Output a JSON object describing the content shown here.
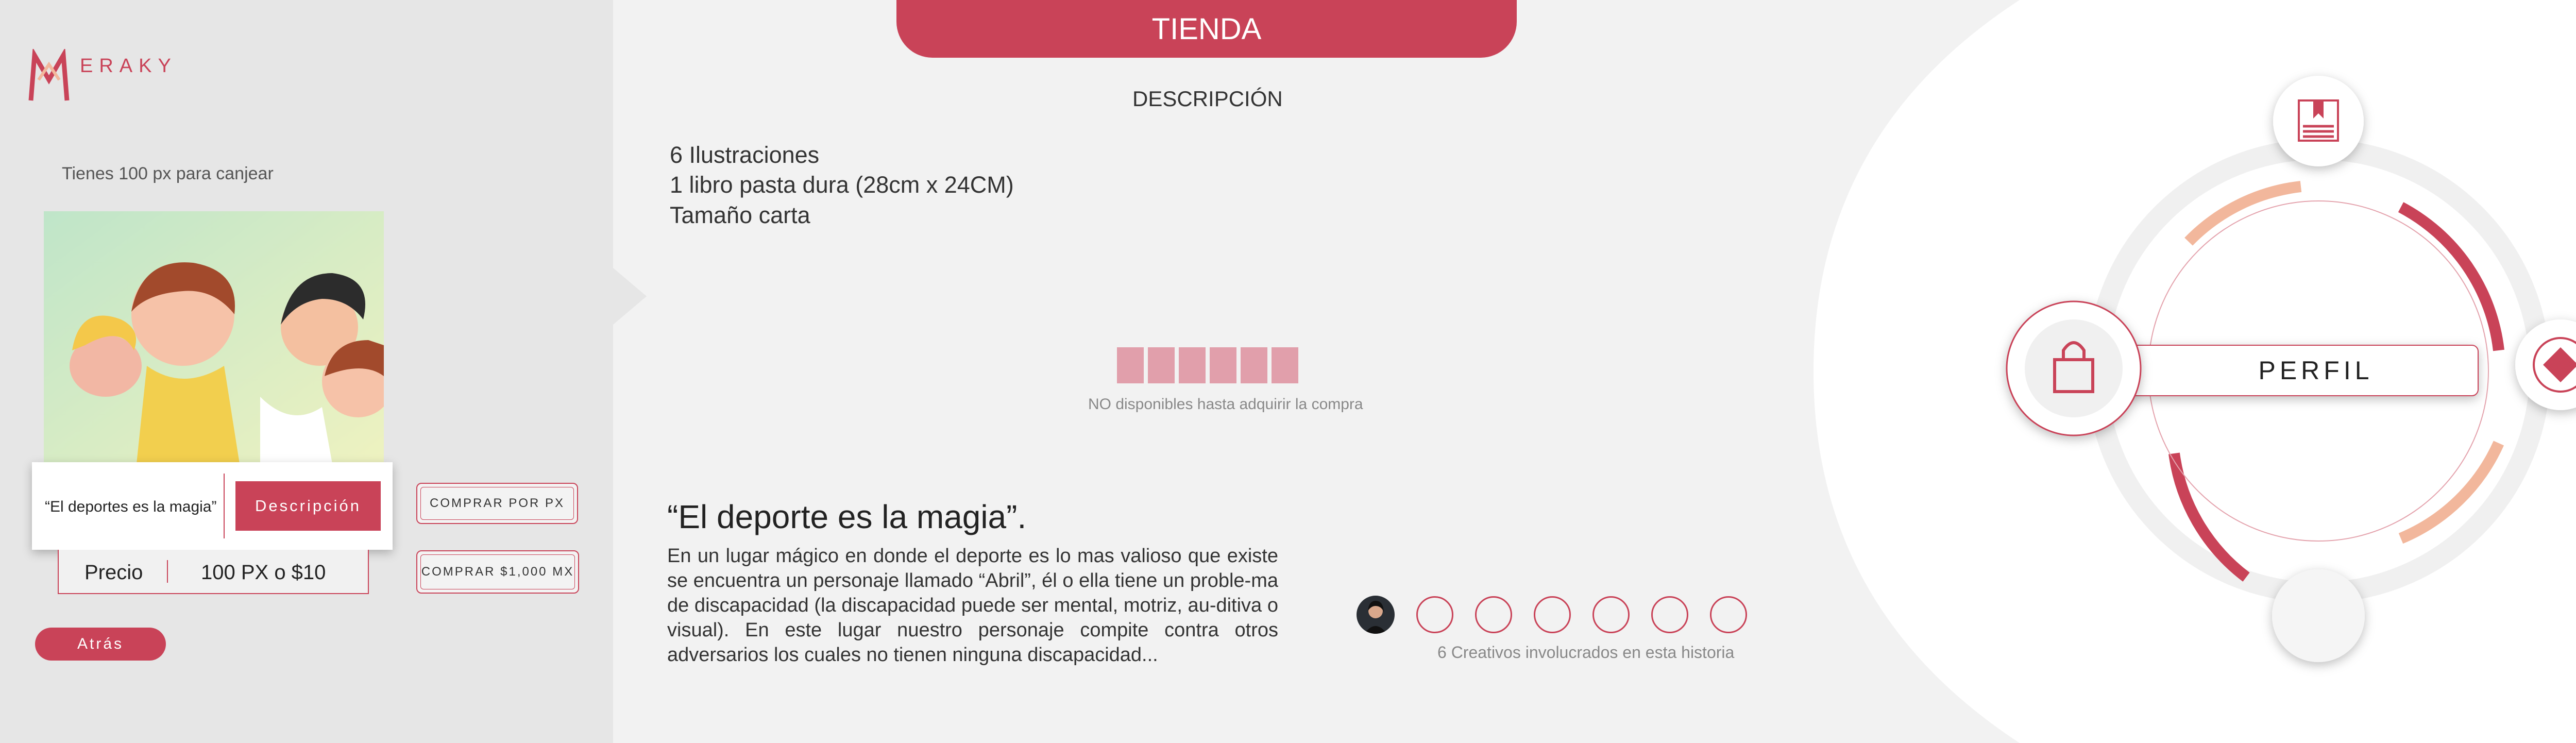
{
  "colors": {
    "accent": "#c94358",
    "accent_light": "#f2b79c",
    "locked": "#e19fab",
    "panel": "#e6e6e6",
    "background": "#f2f2f2"
  },
  "brand": {
    "logo_text": "ERAKY"
  },
  "left": {
    "redeem_text": "Tienes 100 px para canjear",
    "product_title": "“El deportes es la magia”",
    "description_button": "Descripción",
    "buy_px_button": "COMPRAR POR PX",
    "buy_mx_button": "COMPRAR $1,000 MX",
    "price_label": "Precio",
    "price_value": "100 PX o $10",
    "back_button": "Atrás"
  },
  "header": {
    "tab_title": "TIENDA"
  },
  "description": {
    "heading": "DESCRIPCIÓN",
    "features": [
      "6 Ilustraciones",
      "1 libro pasta dura (28cm x 24CM)",
      "Tamaño carta"
    ],
    "locked_note": "NO disponibles hasta adquirir la compra"
  },
  "story": {
    "title": "“El deporte es la magia”.",
    "text": "En un lugar mágico en donde el deporte es lo mas valioso que existe se encuentra un personaje llamado “Abril”, él o ella tiene un proble-ma de discapacidad (la discapacidad puede ser mental, motriz, au-ditiva o visual). En este lugar nuestro personaje compite contra otros adversarios los cuales no tienen ninguna discapacidad..."
  },
  "creatives": {
    "note": "6 Creativos involucrados en esta historia"
  },
  "nav": {
    "center_label": "PERFIL",
    "icons": [
      "book-icon",
      "diamond-icon",
      "shopping-bag-icon"
    ]
  }
}
